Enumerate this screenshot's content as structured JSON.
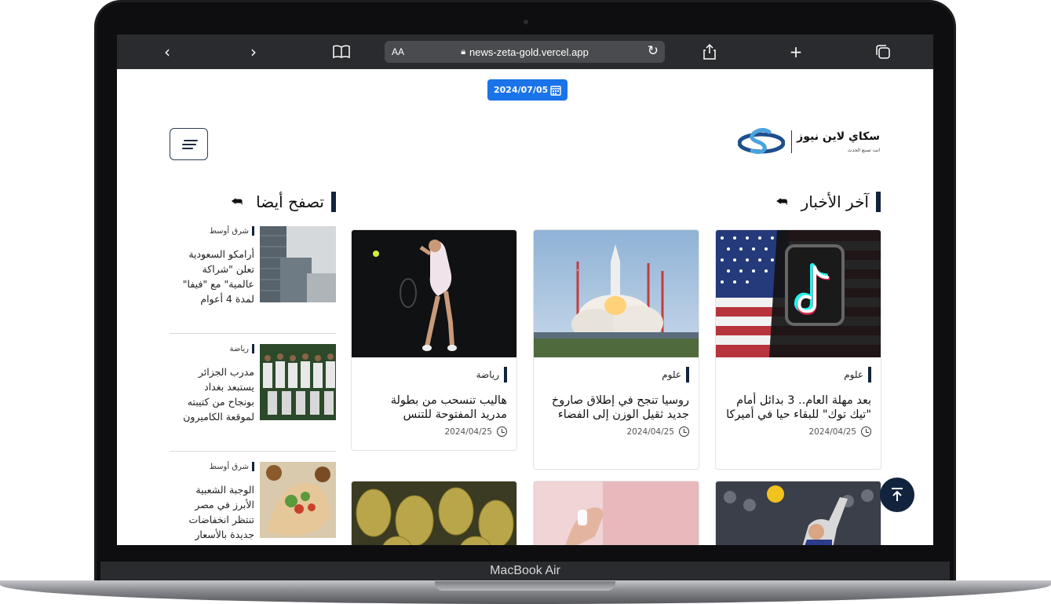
{
  "device": {
    "label": "MacBook Air"
  },
  "browser": {
    "url": "news-zeta-gold.vercel.app",
    "aa_label": "AA",
    "back_icon": "chevron-left-icon",
    "forward_icon": "chevron-right-icon",
    "bookmarks_icon": "book-icon",
    "reload_icon": "reload-icon",
    "share_icon": "share-icon",
    "new_tab_icon": "plus-icon",
    "tabs_icon": "tabs-icon"
  },
  "header": {
    "date": "2024/07/05",
    "logo": {
      "name": "سكاي لاين نيوز",
      "tagline": "انت تصنع الحدث"
    }
  },
  "latest": {
    "heading": "آخر الأخبار",
    "cards": [
      {
        "category": "علوم",
        "title": "بعد مهلة العام.. 3 بدائل أمام \"تيك توك\" للبقاء حيا في أميركا",
        "date": "2024/04/25"
      },
      {
        "category": "علوم",
        "title": "روسيا تنجح في إطلاق صاروخ جديد ثقيل الوزن إلى الفضاء",
        "date": "2024/04/25"
      },
      {
        "category": "رياضة",
        "title": "هاليب تنسحب من بطولة مدريد المفتوحة للتنس",
        "date": "2024/04/25"
      }
    ]
  },
  "browse": {
    "heading": "تصفح أيضا",
    "items": [
      {
        "category": "شرق أوسط",
        "title": "أرامكو السعودية تعلن \"شراكة عالمية\" مع \"فيفا\" لمدة 4 أعوام"
      },
      {
        "category": "رياضة",
        "title": "مدرب الجزائر يستبعد بغداد بونجاح من كتيبته لموقعة الكاميرون"
      },
      {
        "category": "شرق أوسط",
        "title": "الوجبة الشعبية الأبرز في مصر تنتظر انخفاضات جديدة بالأسعار"
      }
    ]
  },
  "colors": {
    "accent": "#12233d",
    "date_pill": "#1a73e8",
    "toolbar": "#2a2b2e"
  }
}
